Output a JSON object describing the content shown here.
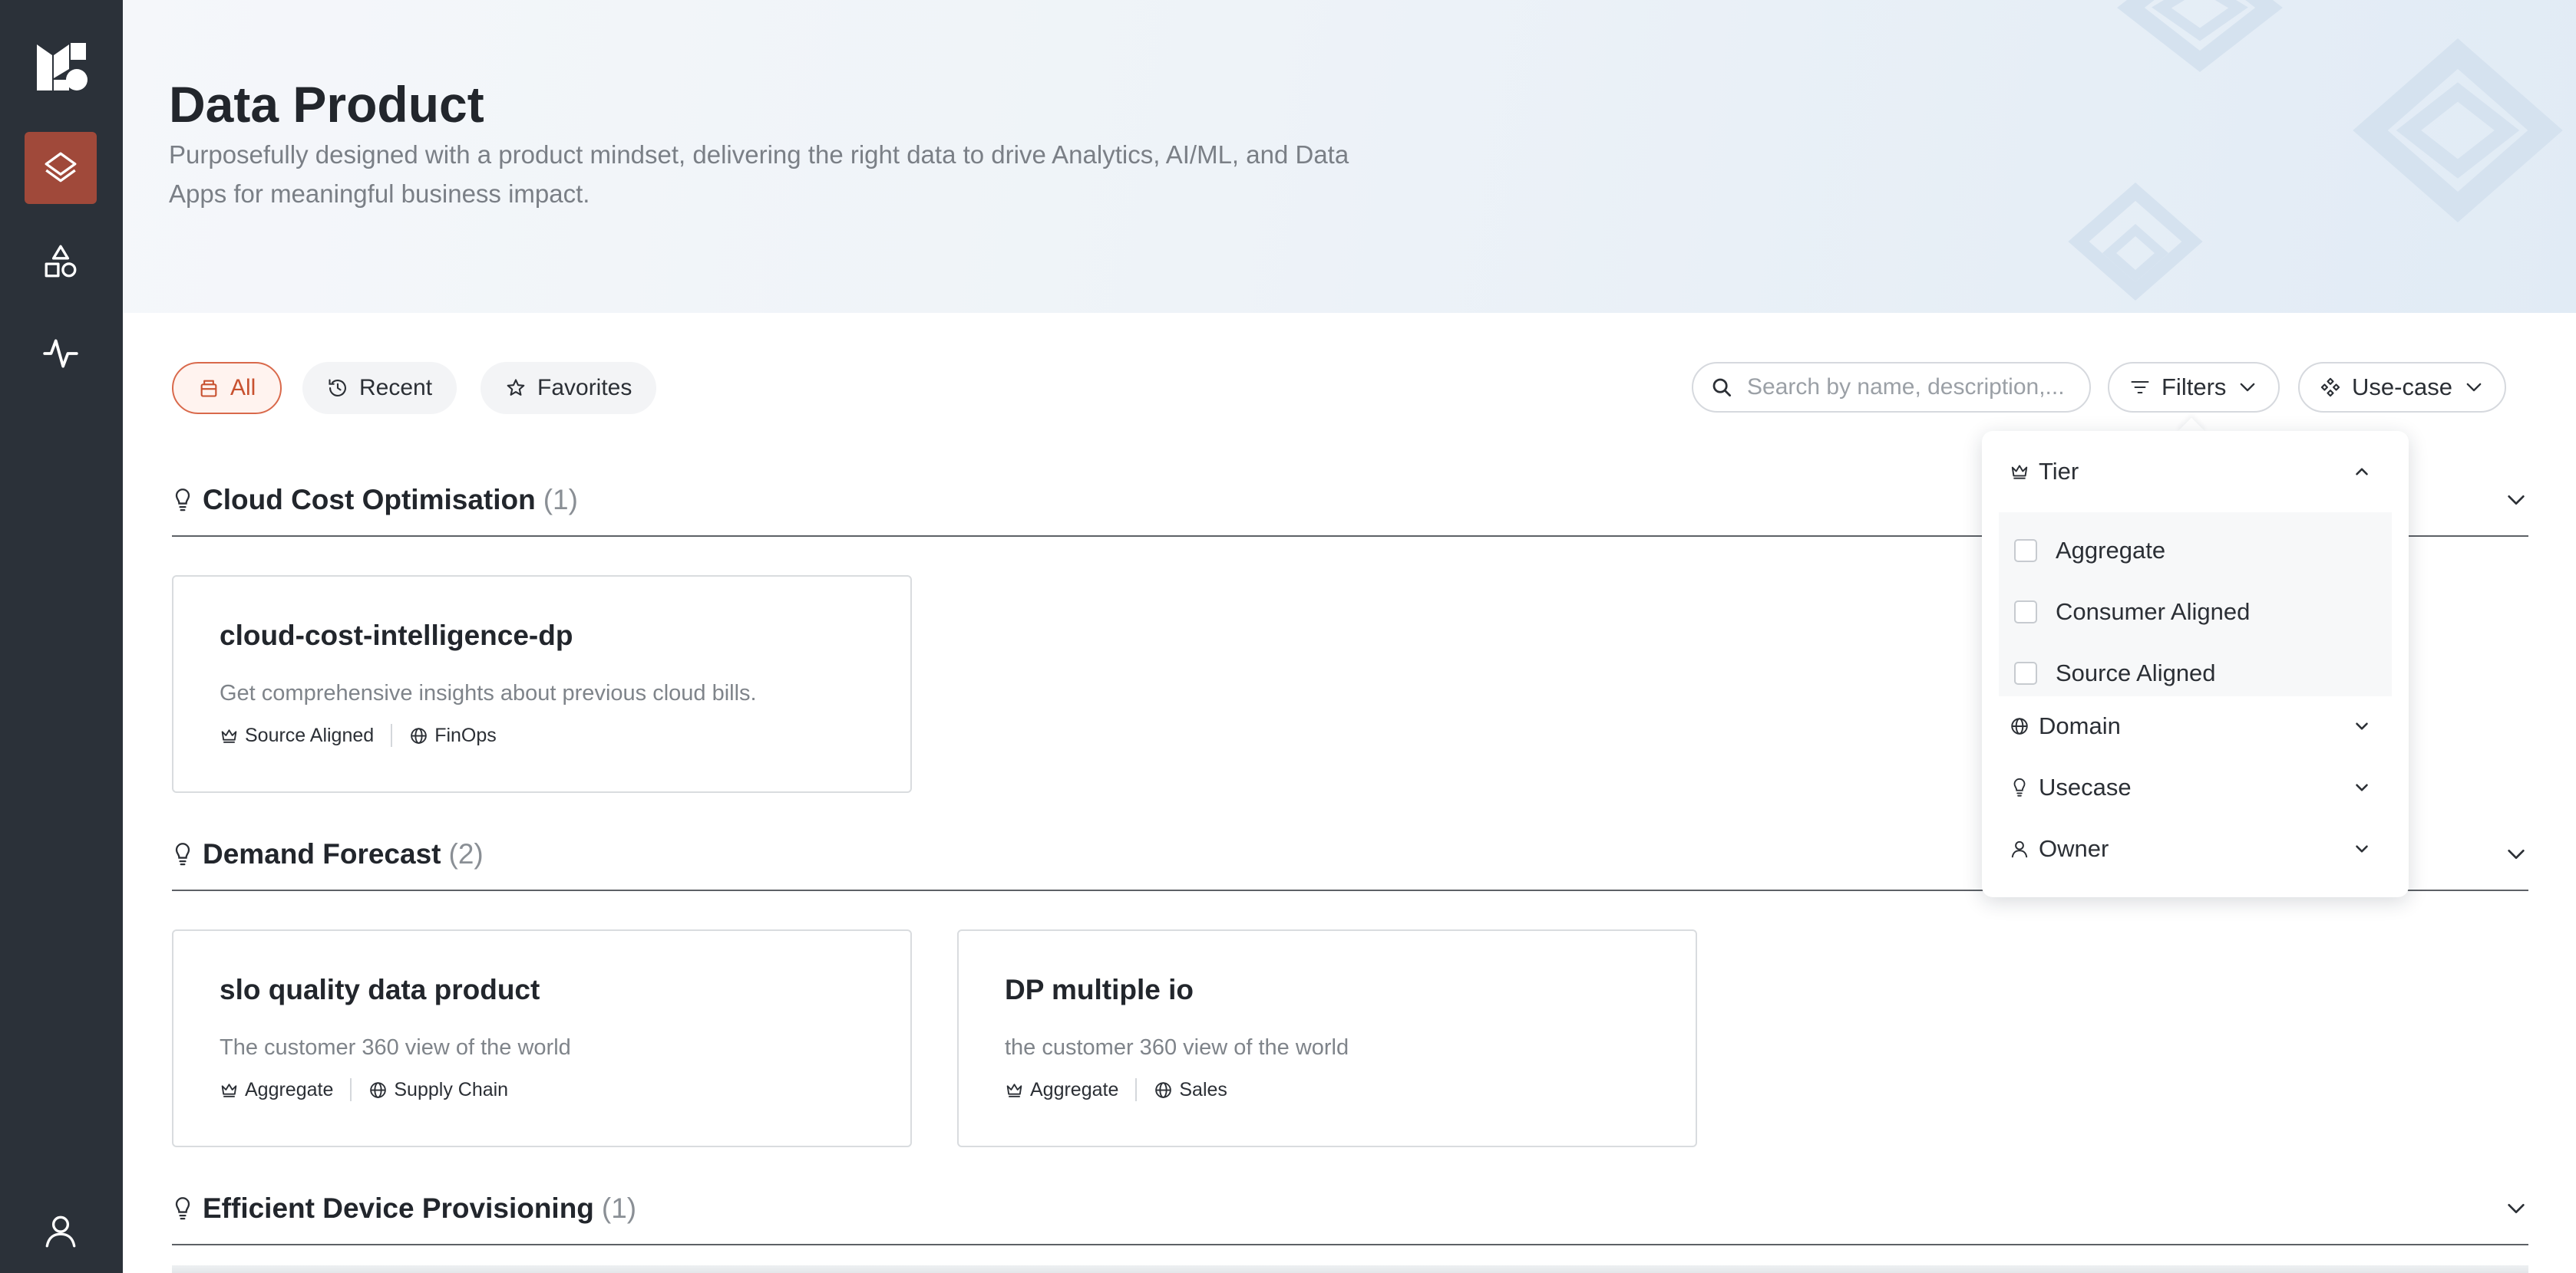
{
  "sidebar": {
    "nav": [
      {
        "icon": "layers-icon",
        "active": true
      },
      {
        "icon": "shapes-icon",
        "active": false
      },
      {
        "icon": "activity-icon",
        "active": false
      }
    ],
    "profile_icon": "user-icon"
  },
  "header": {
    "title": "Data Product",
    "subtitle": "Purposefully designed with a product mindset, delivering the right data to drive Analytics, AI/ML, and Data Apps for meaningful business impact."
  },
  "toolbar": {
    "tabs": [
      {
        "label": "All",
        "icon": "box-icon",
        "active": true
      },
      {
        "label": "Recent",
        "icon": "history-icon",
        "active": false
      },
      {
        "label": "Favorites",
        "icon": "star-icon",
        "active": false
      }
    ],
    "search": {
      "placeholder": "Search by name, description,...",
      "value": ""
    },
    "filters_label": "Filters",
    "usecase_label": "Use-case"
  },
  "sections": [
    {
      "title": "Cloud Cost Optimisation",
      "count": "(1)",
      "cards": [
        {
          "title": "cloud-cost-intelligence-dp",
          "description": "Get comprehensive insights about previous cloud bills.",
          "tier": "Source Aligned",
          "domain": "FinOps"
        }
      ]
    },
    {
      "title": "Demand Forecast",
      "count": "(2)",
      "cards": [
        {
          "title": "slo quality data product",
          "description": "The customer 360 view of the world",
          "tier": "Aggregate",
          "domain": "Supply Chain"
        },
        {
          "title": "DP multiple io",
          "description": "the customer 360 view of the world",
          "tier": "Aggregate",
          "domain": "Sales"
        }
      ]
    },
    {
      "title": "Efficient Device Provisioning",
      "count": "(1)",
      "cards": []
    }
  ],
  "filter_dropdown": {
    "groups": [
      {
        "label": "Tier",
        "icon": "crown-icon",
        "expanded": true,
        "options": [
          "Aggregate",
          "Consumer Aligned",
          "Source Aligned"
        ]
      },
      {
        "label": "Domain",
        "icon": "globe-icon",
        "expanded": false
      },
      {
        "label": "Usecase",
        "icon": "bulb-icon",
        "expanded": false
      },
      {
        "label": "Owner",
        "icon": "user-icon",
        "expanded": false
      }
    ]
  },
  "colors": {
    "sidebar_bg": "#2b3139",
    "sidebar_active": "#a0493a",
    "accent": "#d9694b"
  }
}
